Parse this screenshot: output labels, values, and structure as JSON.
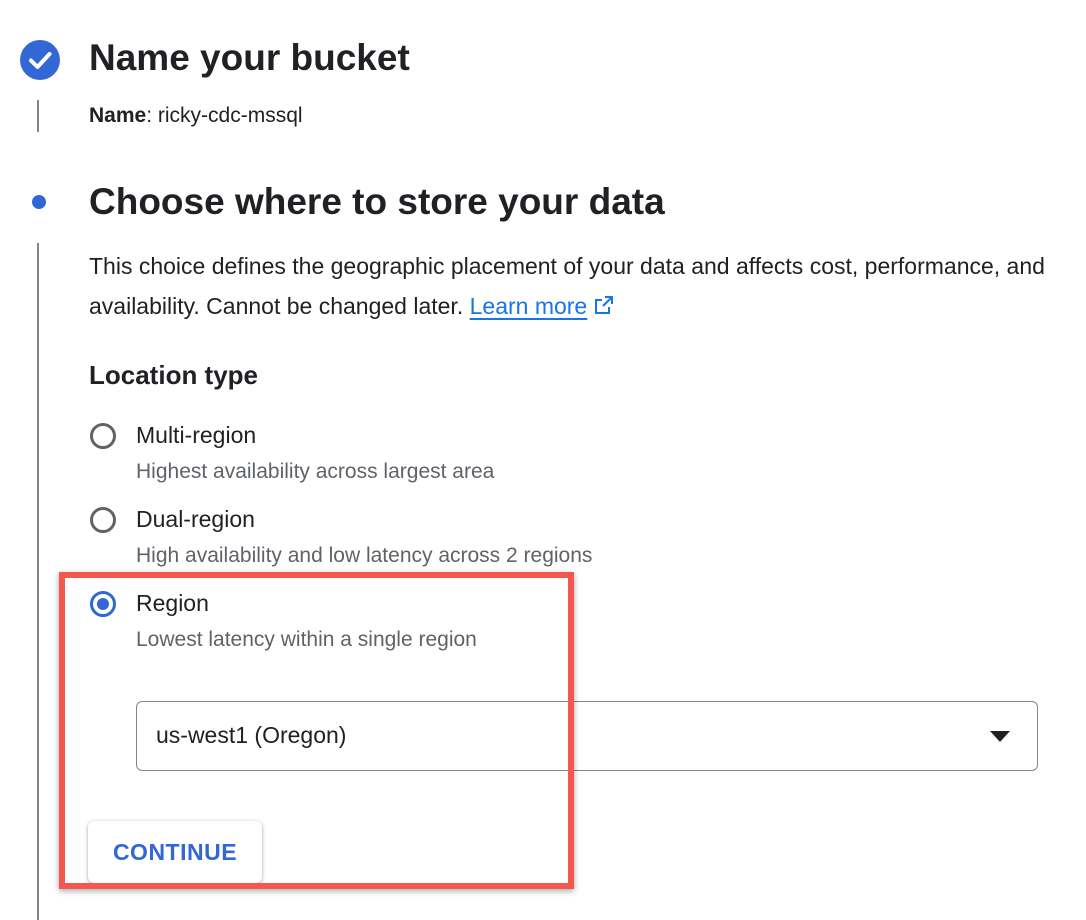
{
  "step1": {
    "title": "Name your bucket",
    "name_label": "Name",
    "name_sep": ":",
    "name_value": "ricky-cdc-mssql",
    "icon": "check-icon"
  },
  "step2": {
    "title": "Choose where to store your data",
    "description": "This choice defines the geographic placement of your data and affects cost, performance, and availability. Cannot be changed later.",
    "learn_more": "Learn more",
    "learn_more_icon": "external-link-icon"
  },
  "location_type": {
    "label": "Location type",
    "options": [
      {
        "label": "Multi-region",
        "description": "Highest availability across largest area",
        "selected": false
      },
      {
        "label": "Dual-region",
        "description": "High availability and low latency across 2 regions",
        "selected": false
      },
      {
        "label": "Region",
        "description": "Lowest latency within a single region",
        "selected": true
      }
    ]
  },
  "region_select": {
    "value": "us-west1 (Oregon)",
    "icon": "dropdown-arrow-icon"
  },
  "continue_button": {
    "label": "CONTINUE"
  },
  "colors": {
    "accent": "#3367d6",
    "link": "#1a73e8",
    "highlight": "#f4574d",
    "text": "#202124",
    "secondary_text": "#5f6368"
  }
}
